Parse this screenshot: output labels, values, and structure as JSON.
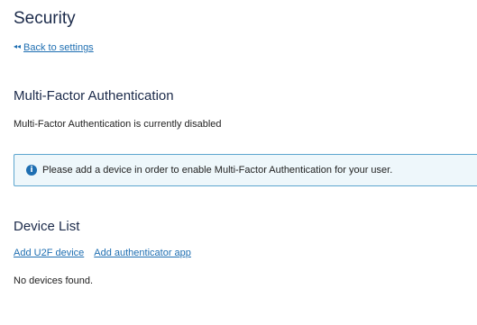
{
  "page": {
    "title": "Security",
    "back_link": {
      "arrow": "◂◂",
      "label": "Back to settings"
    }
  },
  "mfa": {
    "heading": "Multi-Factor Authentication",
    "status": "Multi-Factor Authentication is currently disabled",
    "alert": {
      "icon": "info-icon",
      "icon_glyph": "i",
      "text": "Please add a device in order to enable Multi-Factor Authentication for your user.",
      "background_color": "#eef7fb",
      "border_color": "#5ea6cf"
    }
  },
  "devices": {
    "heading": "Device List",
    "actions": {
      "add_u2f": "Add U2F device",
      "add_authenticator": "Add authenticator app"
    },
    "empty_message": "No devices found."
  },
  "colors": {
    "link": "#1f6fb2",
    "heading": "#1b2a4a"
  }
}
